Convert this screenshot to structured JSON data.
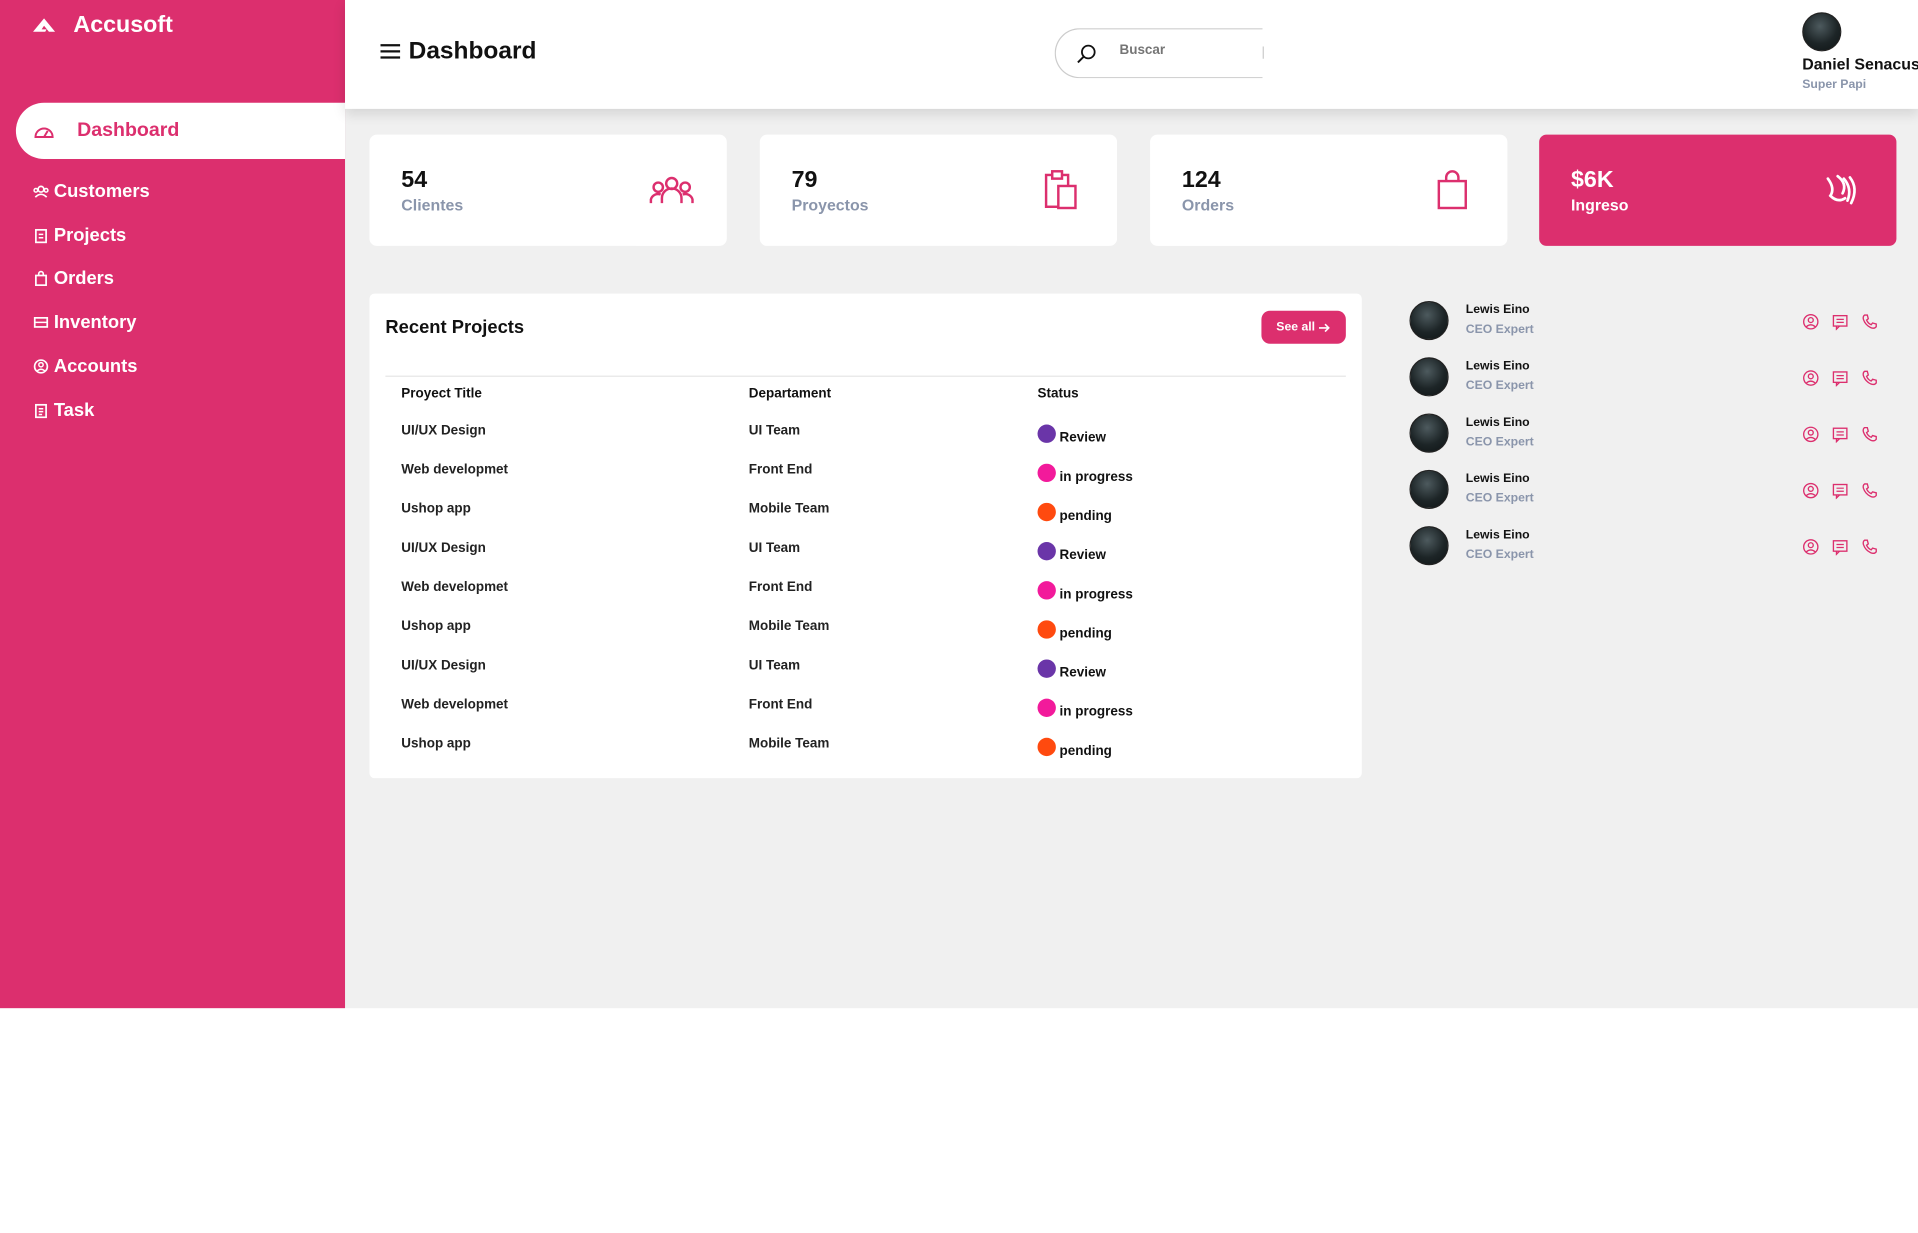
{
  "brand": {
    "name": "Accusoft"
  },
  "sidebar": {
    "active": {
      "label": "Dashboard",
      "icon": "dashboard-icon"
    },
    "items": [
      {
        "label": "Customers",
        "icon": "customers-icon"
      },
      {
        "label": "Projects",
        "icon": "clipboard-icon"
      },
      {
        "label": "Orders",
        "icon": "bag-icon"
      },
      {
        "label": "Inventory",
        "icon": "inventory-icon"
      },
      {
        "label": "Accounts",
        "icon": "account-icon"
      },
      {
        "label": "Task",
        "icon": "task-icon"
      }
    ]
  },
  "header": {
    "title": "Dashboard",
    "search_placeholder": "Buscar",
    "user": {
      "name": "Daniel Senacus",
      "role": "Super Papi"
    }
  },
  "cards": [
    {
      "value": "54",
      "label": "Clientes",
      "icon": "people-icon"
    },
    {
      "value": "79",
      "label": "Proyectos",
      "icon": "clipboard-icon"
    },
    {
      "value": "124",
      "label": "Orders",
      "icon": "bag-icon"
    },
    {
      "value": "$6K",
      "label": "Ingreso",
      "icon": "money-icon"
    }
  ],
  "projects": {
    "title": "Recent Projects",
    "see_all": "See all",
    "columns": [
      "Proyect Title",
      "Departament",
      "Status"
    ],
    "rows": [
      {
        "title": "UI/UX Design",
        "department": "UI Team",
        "status": "Review"
      },
      {
        "title": "Web developmet",
        "department": "Front End",
        "status": "in progress"
      },
      {
        "title": "Ushop app",
        "department": "Mobile Team",
        "status": "pending"
      },
      {
        "title": "UI/UX Design",
        "department": "UI Team",
        "status": "Review"
      },
      {
        "title": "Web developmet",
        "department": "Front End",
        "status": "in progress"
      },
      {
        "title": "Ushop app",
        "department": "Mobile Team",
        "status": "pending"
      },
      {
        "title": "UI/UX Design",
        "department": "UI Team",
        "status": "Review"
      },
      {
        "title": "Web developmet",
        "department": "Front End",
        "status": "in progress"
      },
      {
        "title": "Ushop app",
        "department": "Mobile Team",
        "status": "pending"
      }
    ]
  },
  "status_colors": {
    "Review": "#6a35a8",
    "in progress": "#f21a9b",
    "pending": "#ff4a0f"
  },
  "contacts": [
    {
      "name": "Lewis Eino",
      "role": "CEO Expert"
    },
    {
      "name": "Lewis Eino",
      "role": "CEO Expert"
    },
    {
      "name": "Lewis Eino",
      "role": "CEO Expert"
    },
    {
      "name": "Lewis Eino",
      "role": "CEO Expert"
    },
    {
      "name": "Lewis Eino",
      "role": "CEO Expert"
    }
  ],
  "colors": {
    "accent": "#dc2f6e",
    "muted": "#8a95ab",
    "background": "#f0f0f0"
  }
}
